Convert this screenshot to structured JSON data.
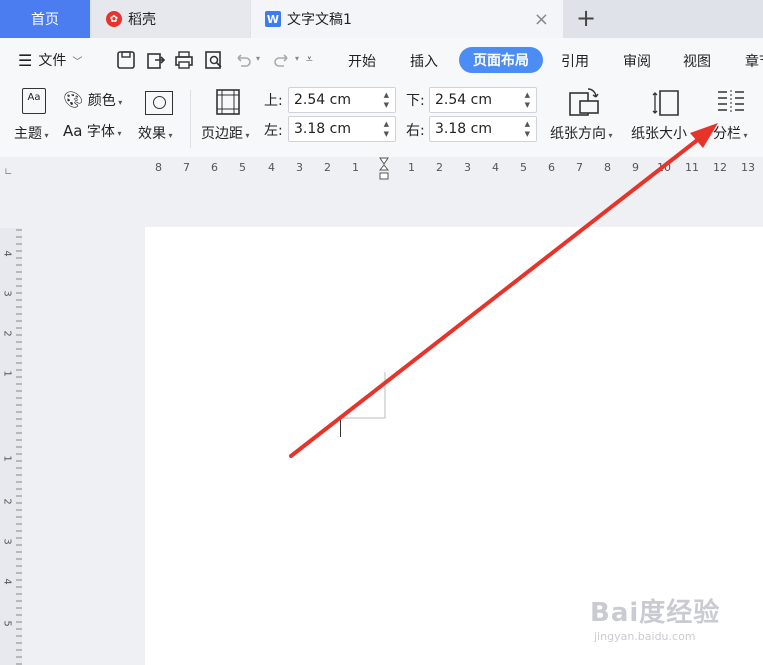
{
  "tabs": {
    "home": "首页",
    "daoke": "稻壳",
    "doc": "文字文稿1",
    "doc_close": "×",
    "add": "+"
  },
  "menu": {
    "file": "文件",
    "items": [
      "开始",
      "插入",
      "页面布局",
      "引用",
      "审阅",
      "视图",
      "章节"
    ],
    "active": "页面布局"
  },
  "ribbon": {
    "theme": "主题",
    "color": "颜色",
    "font": "字体",
    "font_prefix": "Aa",
    "effect": "效果",
    "margins": "页边距",
    "top_label": "上:",
    "top_value": "2.54 cm",
    "bottom_label": "下:",
    "bottom_value": "2.54 cm",
    "left_label": "左:",
    "left_value": "3.18 cm",
    "right_label": "右:",
    "right_value": "3.18 cm",
    "orientation": "纸张方向",
    "size": "纸张大小",
    "columns": "分栏"
  },
  "ruler": {
    "top_numbers": [
      "8",
      "7",
      "6",
      "5",
      "4",
      "3",
      "2",
      "1",
      "1",
      "2",
      "3",
      "4",
      "5",
      "6",
      "7",
      "8",
      "9",
      "10",
      "11",
      "12",
      "13"
    ],
    "left_numbers": [
      "4",
      "3",
      "2",
      "1",
      "1",
      "2",
      "3",
      "4",
      "5"
    ]
  },
  "watermark": {
    "brand": "Bai度经验",
    "url": "jingyan.baidu.com"
  },
  "colors": {
    "accent": "#4b8df5",
    "home_tab": "#4b7cf0",
    "arrow": "#e8332a"
  }
}
